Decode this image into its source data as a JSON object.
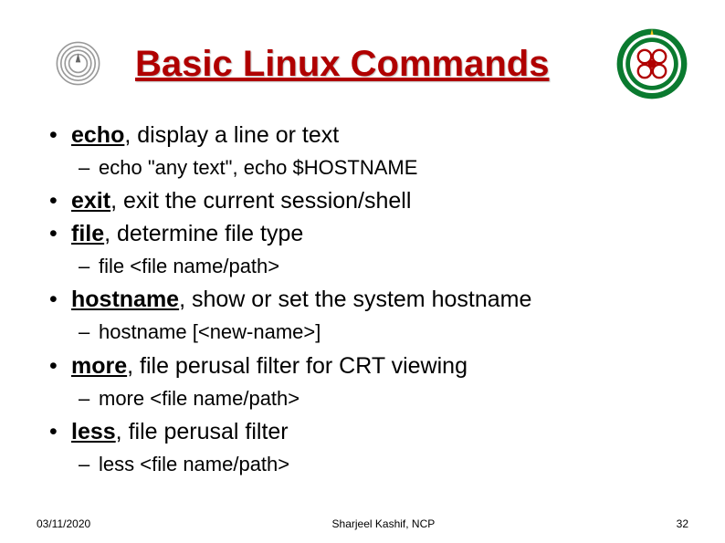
{
  "title": "Basic Linux Commands",
  "logo_left_caption": "",
  "commands": [
    {
      "name": "echo",
      "desc": ", display a line or text",
      "subs": [
        "echo \"any text\", echo $HOSTNAME"
      ]
    },
    {
      "name": "exit",
      "desc": ", exit the current session/shell",
      "subs": []
    },
    {
      "name": "file",
      "desc": ", determine file type",
      "subs": [
        "file <file name/path>"
      ]
    },
    {
      "name": "hostname",
      "desc": ", show or set the system hostname",
      "subs": [
        "hostname [<new-name>]"
      ]
    },
    {
      "name": "more",
      "desc": ", file perusal filter for CRT viewing",
      "subs": [
        "more <file name/path>"
      ]
    },
    {
      "name": "less",
      "desc": ", file perusal filter",
      "subs": [
        "less <file name/path>"
      ]
    }
  ],
  "footer": {
    "date": "03/11/2020",
    "author": "Sharjeel Kashif, NCP",
    "page": "32"
  }
}
